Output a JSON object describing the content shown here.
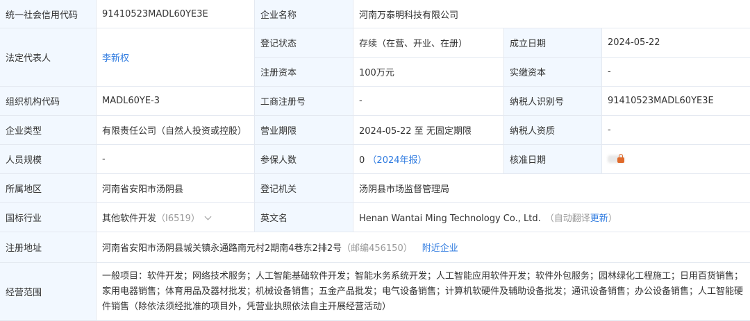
{
  "labels": {
    "credit_code": "统一社会信用代码",
    "company_name": "企业名称",
    "legal_rep": "法定代表人",
    "reg_status": "登记状态",
    "founded_date": "成立日期",
    "reg_capital": "注册资本",
    "paid_capital": "实缴资本",
    "org_code": "组织机构代码",
    "biz_reg_no": "工商注册号",
    "taxpayer_id": "纳税人识别号",
    "company_type": "企业类型",
    "biz_term": "营业期限",
    "taxpayer_qual": "纳税人资质",
    "staff_size": "人员规模",
    "insured_count": "参保人数",
    "approval_date": "核准日期",
    "region": "所属地区",
    "reg_authority": "登记机关",
    "industry": "国标行业",
    "english_name": "英文名",
    "reg_address": "注册地址",
    "biz_scope": "经营范围"
  },
  "values": {
    "credit_code": "91410523MADL60YE3E",
    "company_name": "河南万泰明科技有限公司",
    "legal_rep": "李新权",
    "reg_status": "存续（在营、开业、在册）",
    "founded_date": "2024-05-22",
    "reg_capital": "100万元",
    "paid_capital": "-",
    "org_code": "MADL60YE-3",
    "biz_reg_no": "-",
    "taxpayer_id": "91410523MADL60YE3E",
    "company_type": "有限责任公司（自然人投资或控股）",
    "biz_term": "2024-05-22 至 无固定期限",
    "taxpayer_qual": "-",
    "staff_size": "-",
    "insured_count": "0",
    "insured_year": "（2024年报）",
    "region": "河南省安阳市汤阴县",
    "reg_authority": "汤阴县市场监督管理局",
    "industry": "其他软件开发",
    "industry_code": "（I6519）",
    "english_name": "Henan Wantai Ming Technology Co., Ltd.",
    "auto_translate": "（自动翻译",
    "update_link": "更新",
    "auto_translate_close": "）",
    "reg_address": "河南省安阳市汤阴县城关镇永通路南元村2期南4巷东2排2号",
    "postcode": "（邮编456150）",
    "nearby_link": "附近企业",
    "biz_scope": "一般项目：软件开发；网络技术服务；人工智能基础软件开发；智能水务系统开发；人工智能应用软件开发；软件外包服务；园林绿化工程施工；日用百货销售；家用电器销售；体育用品及器材批发；机械设备销售；五金产品批发；电气设备销售；计算机软硬件及辅助设备批发；通讯设备销售；办公设备销售；人工智能硬件销售（除依法须经批准的项目外，凭营业执照依法自主开展经营活动）"
  },
  "icons": {
    "lock": "lock-icon",
    "chevron": "chevron-down-icon"
  },
  "colors": {
    "label_bg": "#f2f8ff",
    "border": "#e4e9f1",
    "link": "#2f7be0",
    "muted": "#999999",
    "lock": "#e06a2b"
  }
}
